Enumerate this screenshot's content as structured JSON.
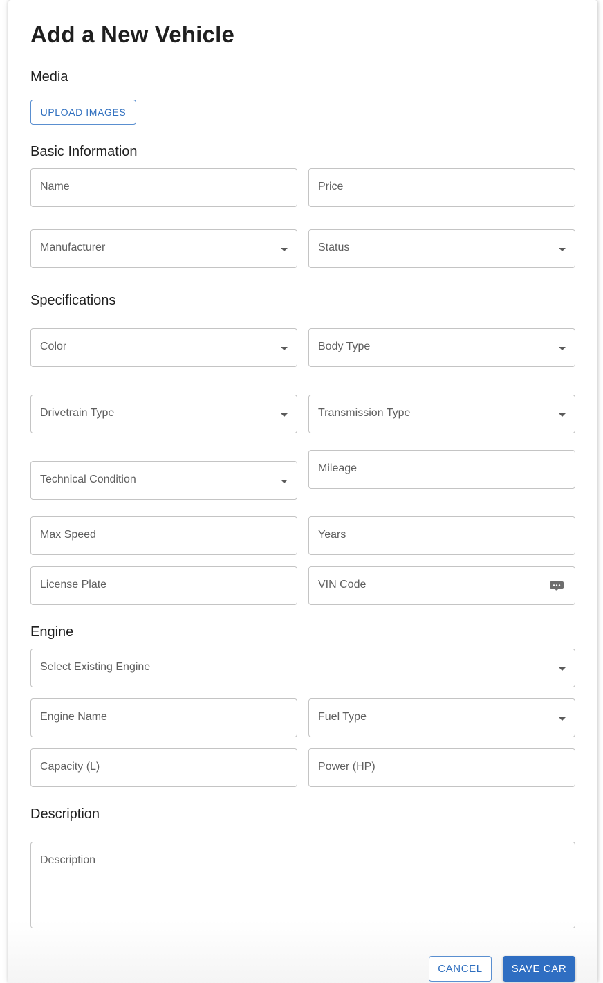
{
  "dialog": {
    "title": "Add a New Vehicle"
  },
  "media": {
    "heading": "Media",
    "upload_label": "UPLOAD IMAGES"
  },
  "basic": {
    "heading": "Basic Information",
    "name": "Name",
    "price": "Price",
    "manufacturer": "Manufacturer",
    "status": "Status"
  },
  "specs": {
    "heading": "Specifications",
    "color": "Color",
    "body_type": "Body Type",
    "drivetrain_type": "Drivetrain Type",
    "transmission_type": "Transmission Type",
    "technical_condition": "Technical Condition",
    "mileage": "Mileage",
    "max_speed": "Max Speed",
    "years": "Years",
    "license_plate": "License Plate",
    "vin_code": "VIN Code"
  },
  "engine": {
    "heading": "Engine",
    "select_existing": "Select Existing Engine",
    "engine_name": "Engine Name",
    "fuel_type": "Fuel Type",
    "capacity": "Capacity (L)",
    "power": "Power (HP)"
  },
  "description": {
    "heading": "Description",
    "placeholder": "Description"
  },
  "actions": {
    "cancel_label": "CANCEL",
    "save_label": "SAVE CAR"
  },
  "icons": {
    "dropdown": "chevron-down-icon",
    "vin_helper": "chat-bubble-icon"
  },
  "colors": {
    "accent": "#2f6ec2",
    "border": "#c4c4c4",
    "label": "#5f5f5f"
  }
}
